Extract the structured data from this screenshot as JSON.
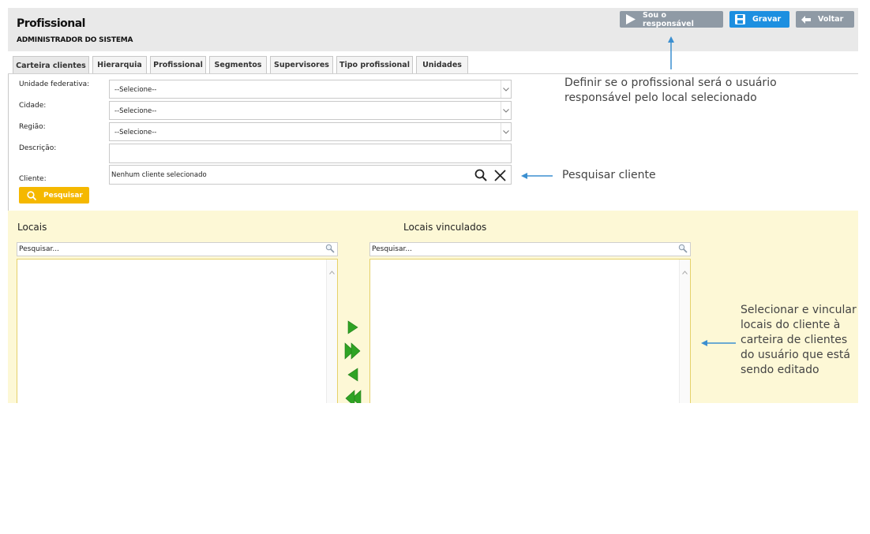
{
  "header": {
    "title": "Profissional",
    "subtitle": "ADMINISTRADOR DO SISTEMA",
    "buttons": {
      "sou_responsavel": "Sou o responsável",
      "gravar": "Gravar",
      "voltar": "Voltar"
    }
  },
  "tabs": [
    {
      "label": "Carteira clientes",
      "active": true
    },
    {
      "label": "Hierarquia",
      "active": false
    },
    {
      "label": "Profissional",
      "active": false
    },
    {
      "label": "Segmentos",
      "active": false
    },
    {
      "label": "Supervisores",
      "active": false
    },
    {
      "label": "Tipo profissional",
      "active": false
    },
    {
      "label": "Unidades",
      "active": false
    }
  ],
  "form": {
    "uf_label": "Unidade federativa:",
    "uf_value": "--Selecione--",
    "cidade_label": "Cidade:",
    "cidade_value": "--Selecione--",
    "regiao_label": "Região:",
    "regiao_value": "--Selecione--",
    "descricao_label": "Descrição:",
    "descricao_value": "",
    "cliente_label": "Cliente:",
    "cliente_value": "Nenhum cliente selecionado",
    "pesquisar_button": "Pesquisar"
  },
  "locais": {
    "title": "Locais",
    "search_placeholder": "Pesquisar..."
  },
  "locais_vinculados": {
    "title": "Locais vinculados",
    "search_placeholder": "Pesquisar..."
  },
  "annotations": {
    "responsavel_line1": "Definir se o profissional será o usuário",
    "responsavel_line2": "responsável pelo local selecionado",
    "pesquisar_cliente": "Pesquisar cliente",
    "vincular_line1": "Selecionar e vincular",
    "vincular_line2": "locais do cliente à",
    "vincular_line3": "carteira de clientes",
    "vincular_line4": "do usuário que está",
    "vincular_line5": "sendo editado"
  },
  "colors": {
    "gravar": "#1d8fe0",
    "secondary_button": "#8f9aa5",
    "pesquisar": "#f5b800",
    "panel_bg": "#fdf8d6",
    "annotation_arrow": "#3b8fd0",
    "transfer_arrow": "#2fa324"
  }
}
